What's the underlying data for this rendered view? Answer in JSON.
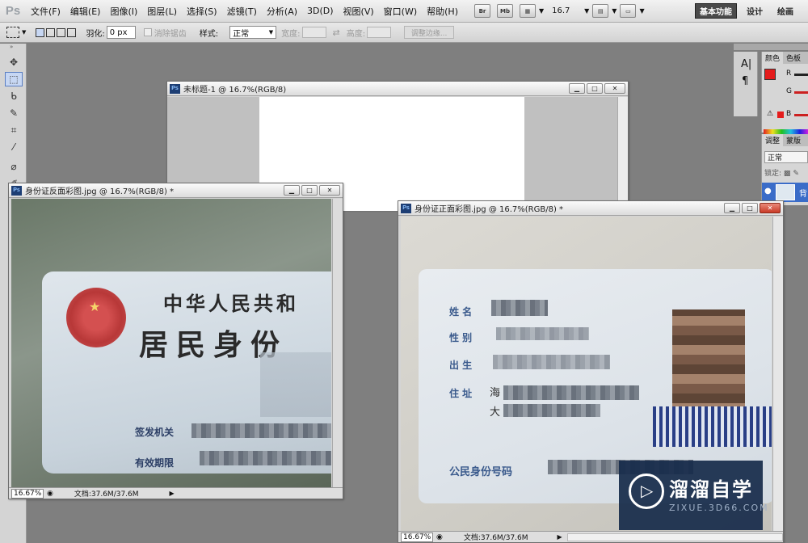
{
  "app": {
    "logo": "Ps",
    "menu": [
      "文件(F)",
      "编辑(E)",
      "图像(I)",
      "图层(L)",
      "选择(S)",
      "滤镜(T)",
      "分析(A)",
      "3D(D)",
      "视图(V)",
      "窗口(W)",
      "帮助(H)"
    ],
    "bridge_btn": "Br",
    "minibridge_btn": "Mb",
    "zoom": "16.7",
    "workspaces": [
      "基本功能",
      "设计",
      "绘画"
    ]
  },
  "options": {
    "feather_label": "羽化:",
    "feather_value": "0 px",
    "antialias_label": "消除锯齿",
    "style_label": "样式:",
    "style_value": "正常",
    "width_label": "宽度:",
    "height_label": "高度:",
    "refine_btn": "调整边缘..."
  },
  "panels": {
    "color_tabs": [
      "颜色",
      "色板"
    ],
    "channels": [
      "R",
      "G",
      "B"
    ],
    "adjust_tabs": [
      "调整",
      "蒙版"
    ],
    "blend_mode": "正常",
    "lock_label": "锁定:",
    "layer_label": "背",
    "accent_red": "#e41c1c"
  },
  "doc_untitled": {
    "title": "未标题-1 @ 16.7%(RGB/8)"
  },
  "doc_back": {
    "title": "身份证反面彩图.jpg @ 16.7%(RGB/8) *",
    "zoom": "16.67%",
    "docsize": "文档:37.6M/37.6M",
    "card_line1": "中华人民共和",
    "card_line2": "居民身份",
    "issuer_label": "签发机关",
    "validity_label": "有效期限"
  },
  "doc_front": {
    "title": "身份证正面彩图.jpg @ 16.7%(RGB/8) *",
    "zoom": "16.67%",
    "docsize": "文档:37.6M/37.6M",
    "name_label": "姓 名",
    "sex_label": "性 别",
    "birth_label": "出 生",
    "address_label": "住 址",
    "address_char": "海",
    "address_char2": "大",
    "id_label": "公民身份号码"
  },
  "watermark": {
    "brand": "溜溜自学",
    "url": "ZIXUE.3D66.COM"
  }
}
